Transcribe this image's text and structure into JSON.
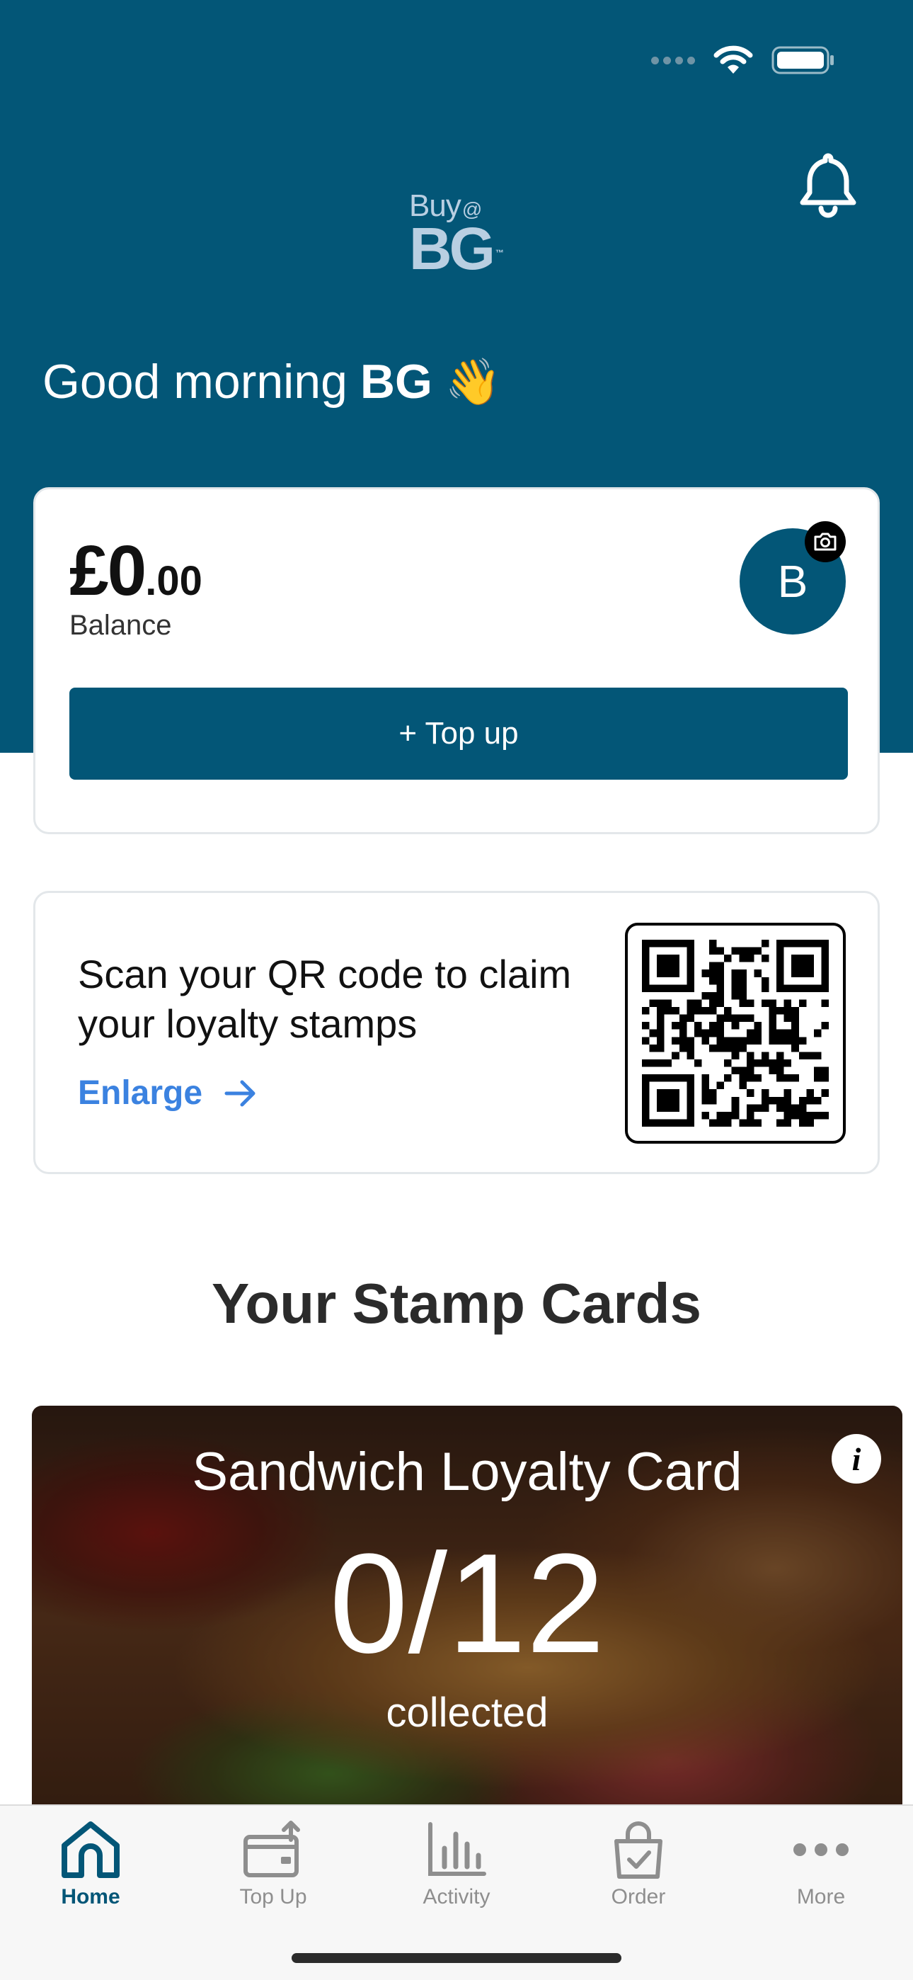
{
  "header": {
    "logo_top": "Buy",
    "logo_at": "@",
    "logo_main": "BG",
    "logo_tm": "™",
    "greeting_prefix": "Good morning",
    "greeting_name": "BG",
    "greeting_emoji": "👋"
  },
  "balance": {
    "amount_main": "£0",
    "amount_decimal": ".00",
    "label": "Balance",
    "avatar_initial": "B",
    "topup_label": "+ Top up"
  },
  "qr": {
    "text": "Scan your QR code to claim your loyalty stamps",
    "enlarge_label": "Enlarge"
  },
  "stamp_section": {
    "title": "Your Stamp Cards",
    "cards": [
      {
        "title": "Sandwich Loyalty Card",
        "collected": 0,
        "total": 12,
        "count_text": "0/12",
        "collected_label": "collected"
      }
    ]
  },
  "tabs": [
    {
      "label": "Home",
      "icon": "home-icon",
      "active": true
    },
    {
      "label": "Top Up",
      "icon": "wallet-upload-icon",
      "active": false
    },
    {
      "label": "Activity",
      "icon": "bar-chart-icon",
      "active": false
    },
    {
      "label": "Order",
      "icon": "shopping-bag-icon",
      "active": false
    },
    {
      "label": "More",
      "icon": "more-dots-icon",
      "active": false
    }
  ],
  "colors": {
    "brand": "#035677",
    "link": "#3b82e0",
    "inactive_tab": "#8e8e8e"
  }
}
